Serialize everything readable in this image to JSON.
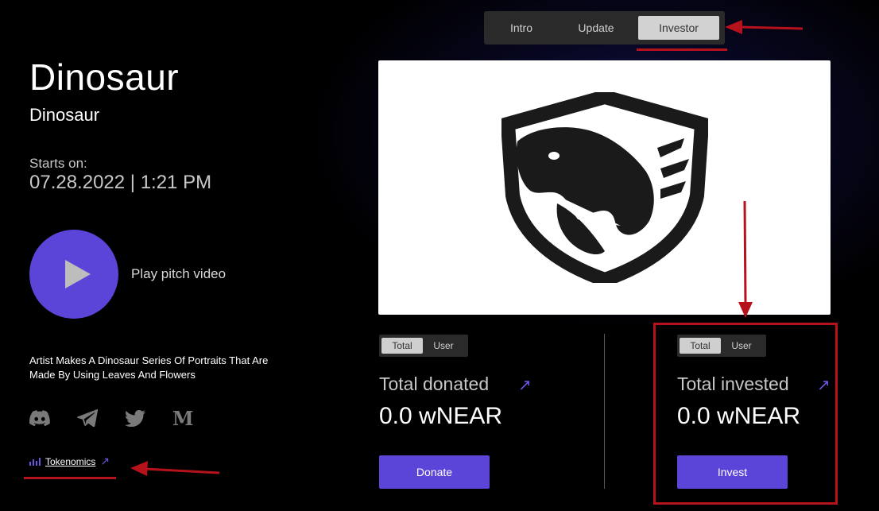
{
  "project": {
    "title": "Dinosaur",
    "subtitle": "Dinosaur",
    "starts_label": "Starts on:",
    "starts_value": "07.28.2022 | 1:21 PM",
    "play_label": "Play pitch video",
    "description": "Artist Makes A Dinosaur Series Of Portraits That Are Made By Using Leaves And Flowers",
    "tokenomics_label": "Tokenomics"
  },
  "socials": [
    "discord-icon",
    "telegram-icon",
    "twitter-icon",
    "medium-icon"
  ],
  "tabs": [
    {
      "label": "Intro",
      "active": false
    },
    {
      "label": "Update",
      "active": false
    },
    {
      "label": "Investor",
      "active": true
    }
  ],
  "donated": {
    "toggle": [
      "Total",
      "User"
    ],
    "label": "Total donated",
    "value": "0.0 wNEAR",
    "button": "Donate"
  },
  "invested": {
    "toggle": [
      "Total",
      "User"
    ],
    "label": "Total invested",
    "value": "0.0 wNEAR",
    "button": "Invest"
  },
  "colors": {
    "accent": "#5b44d8",
    "annotation": "#b5121b",
    "background": "#000000"
  }
}
